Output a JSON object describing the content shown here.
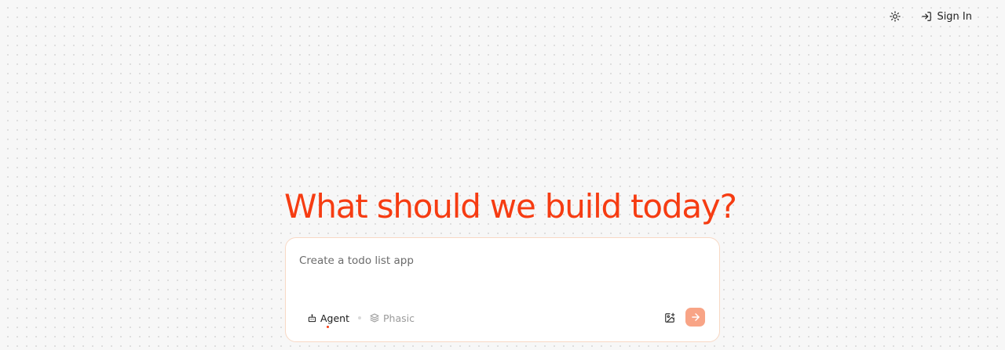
{
  "header": {
    "theme_icon": "sun-icon",
    "signin_icon": "sign-in-icon",
    "signin_label": "Sign In"
  },
  "hero": {
    "heading": "What should we build today?",
    "accent_color": "#f63c12"
  },
  "prompt": {
    "placeholder": "Create a todo list app",
    "value": "",
    "modes": [
      {
        "label": "Agent",
        "icon": "robot-icon",
        "active": true
      },
      {
        "label": "Phasic",
        "icon": "layers-icon",
        "active": false
      }
    ],
    "image_icon": "image-add-icon",
    "send_icon": "arrow-right-icon",
    "send_color": "#f8a486"
  }
}
